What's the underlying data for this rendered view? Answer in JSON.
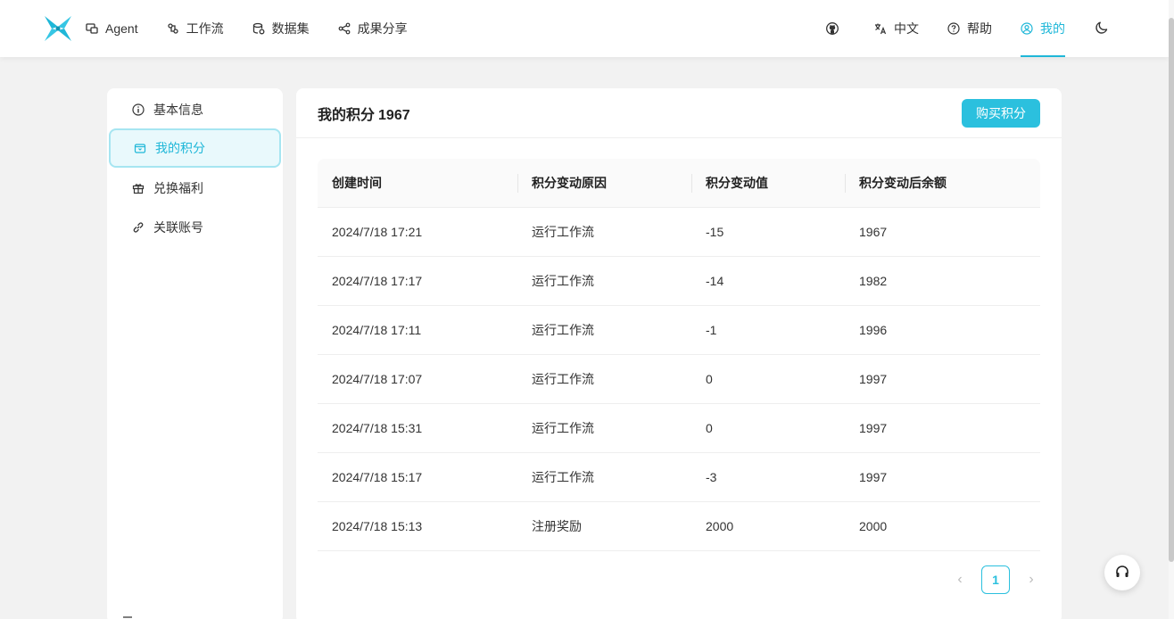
{
  "nav": {
    "left": [
      {
        "label": "Agent",
        "icon": "agent-icon"
      },
      {
        "label": "工作流",
        "icon": "workflow-icon"
      },
      {
        "label": "数据集",
        "icon": "dataset-icon"
      },
      {
        "label": "成果分享",
        "icon": "share-icon"
      }
    ],
    "right": {
      "language": "中文",
      "help": "帮助",
      "mine": "我的"
    }
  },
  "sidebar": {
    "items": [
      {
        "label": "基本信息",
        "icon": "info-icon"
      },
      {
        "label": "我的积分",
        "icon": "points-icon",
        "active": true
      },
      {
        "label": "兑换福利",
        "icon": "gift-icon"
      },
      {
        "label": "关联账号",
        "icon": "link-icon"
      }
    ]
  },
  "panel": {
    "title": "我的积分",
    "points": "1967",
    "buy_label": "购买积分"
  },
  "table": {
    "headers": [
      "创建时间",
      "积分变动原因",
      "积分变动值",
      "积分变动后余额"
    ],
    "rows": [
      [
        "2024/7/18 17:21",
        "运行工作流",
        "-15",
        "1967"
      ],
      [
        "2024/7/18 17:17",
        "运行工作流",
        "-14",
        "1982"
      ],
      [
        "2024/7/18 17:11",
        "运行工作流",
        "-1",
        "1996"
      ],
      [
        "2024/7/18 17:07",
        "运行工作流",
        "0",
        "1997"
      ],
      [
        "2024/7/18 15:31",
        "运行工作流",
        "0",
        "1997"
      ],
      [
        "2024/7/18 15:17",
        "运行工作流",
        "-3",
        "1997"
      ],
      [
        "2024/7/18 15:13",
        "注册奖励",
        "2000",
        "2000"
      ]
    ]
  },
  "pagination": {
    "current": "1",
    "prev": "‹",
    "next": "›"
  },
  "colors": {
    "accent": "#2bc0de",
    "active_bg": "#e9f9fc",
    "page_bg": "#f2f2f2"
  }
}
